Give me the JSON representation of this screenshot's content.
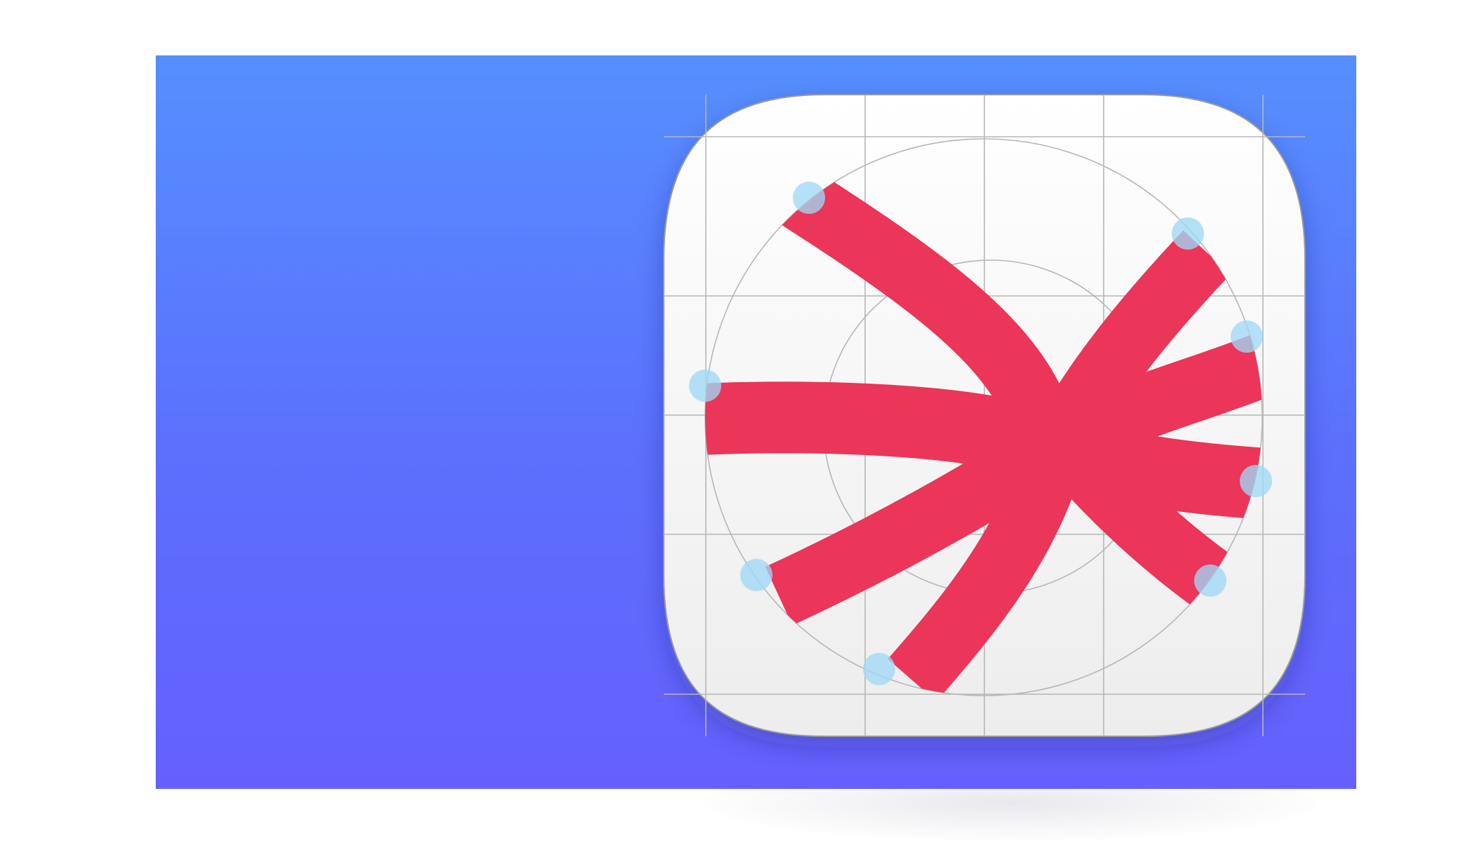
{
  "colors": {
    "background": "#ffffff",
    "banner_top": "#558ffe",
    "banner_bottom": "#6560fd",
    "icon_face_top": "#ffffff",
    "icon_face_bottom": "#efefef",
    "icon_outline": "#9a9a9a",
    "grid_line": "#b8b8b8",
    "stroke_mark": "#eb3559",
    "control_point": "#9fd9f5"
  },
  "icons": {
    "app_icon": "app-icon-template",
    "mark": "asterisk-swoosh-mark"
  }
}
